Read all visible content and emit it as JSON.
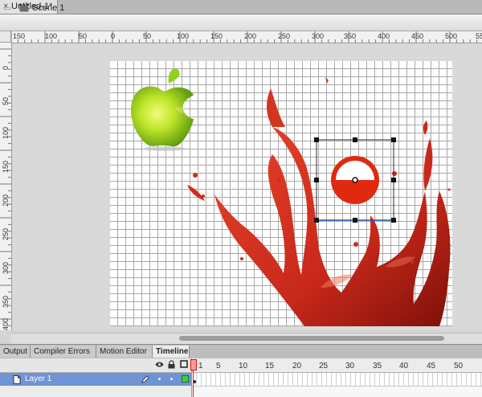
{
  "document_tab": {
    "close_label": "×",
    "title": "Untitled-1*"
  },
  "edit_bar": {
    "back_icon": "left-arrow-icon",
    "scene_icon": "scene-clapper-icon",
    "scene_label": "Scene 1"
  },
  "rulers": {
    "horizontal_labels": [
      "150",
      "100",
      "50",
      "0",
      "50",
      "100",
      "150",
      "200",
      "250",
      "300",
      "350",
      "400",
      "450",
      "500",
      "550"
    ],
    "vertical_labels": [
      "0",
      "50",
      "100",
      "150",
      "200",
      "250",
      "300",
      "350",
      "400"
    ]
  },
  "panel_tabs": [
    {
      "label": "Output"
    },
    {
      "label": "Compiler Errors"
    },
    {
      "label": "Motion Editor"
    },
    {
      "label": "Timeline"
    }
  ],
  "timeline": {
    "header_icons": [
      "eye-icon",
      "lock-icon",
      "outline-square-icon"
    ],
    "frame_numbers": [
      "1",
      "5",
      "10",
      "15",
      "20",
      "25",
      "30",
      "35",
      "40",
      "45",
      "50"
    ],
    "current_frame": 1,
    "layer": {
      "name": "Layer 1",
      "icon": "layer-page-icon",
      "pencil_icon": "pencil-icon",
      "color": "#3fcf3f"
    }
  },
  "colors": {
    "layer_highlight": "#6e93d6",
    "splash_red": "#d7301c",
    "apple_green": "#9ccf1a",
    "playhead": "#e02020"
  }
}
